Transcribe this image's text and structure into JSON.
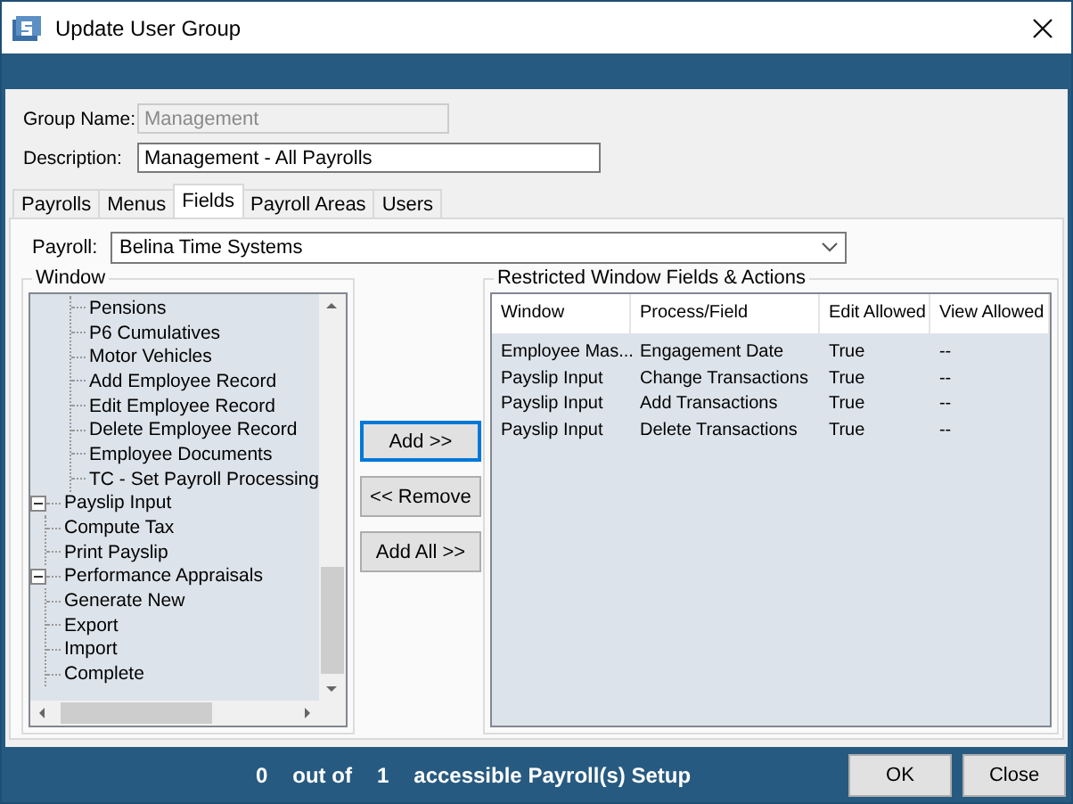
{
  "window": {
    "title": "Update User Group"
  },
  "form": {
    "group_name": {
      "label": "Group Name:",
      "value": "Management",
      "disabled": true
    },
    "description": {
      "label": "Description:",
      "value": "Management - All Payrolls",
      "disabled": false
    }
  },
  "tabs": [
    {
      "label": "Payrolls",
      "selected": false
    },
    {
      "label": "Menus",
      "selected": false
    },
    {
      "label": "Fields",
      "selected": true
    },
    {
      "label": "Payroll Areas",
      "selected": false
    },
    {
      "label": "Users",
      "selected": false
    }
  ],
  "payroll": {
    "label": "Payroll:",
    "value": "Belina Time Systems"
  },
  "window_group": {
    "title": "Window",
    "tree": [
      {
        "children": [
          {
            "label": "Pensions"
          },
          {
            "label": "P6 Cumulatives"
          },
          {
            "label": "Motor Vehicles"
          },
          {
            "label": "Add Employee Record"
          },
          {
            "label": "Edit Employee Record"
          },
          {
            "label": "Delete Employee Record"
          },
          {
            "label": "Employee Documents"
          },
          {
            "label": "TC - Set Payroll Processing"
          }
        ]
      },
      {
        "label": "Payslip Input",
        "expanded": true,
        "children": [
          {
            "label": "Compute Tax"
          },
          {
            "label": "Print Payslip"
          }
        ]
      },
      {
        "label": "Performance Appraisals",
        "expanded": true,
        "children": [
          {
            "label": "Generate New"
          },
          {
            "label": "Export"
          },
          {
            "label": "Import"
          },
          {
            "label": "Complete"
          }
        ]
      }
    ]
  },
  "buttons": [
    {
      "label": "Add >>",
      "focused": true
    },
    {
      "label": "<< Remove",
      "focused": false
    },
    {
      "label": "Add All >>",
      "focused": false
    }
  ],
  "restricted": {
    "title": "Restricted Window Fields & Actions",
    "columns": [
      "Window",
      "Process/Field",
      "Edit Allowed",
      "View Allowed"
    ],
    "rows": [
      [
        "Employee Mas...",
        "Engagement Date",
        "True",
        "--"
      ],
      [
        "Payslip Input",
        "Change Transactions",
        "True",
        "--"
      ],
      [
        "Payslip Input",
        "Add Transactions",
        "True",
        "--"
      ],
      [
        "Payslip Input",
        "Delete Transactions",
        "True",
        "--"
      ]
    ]
  },
  "status_bar": {
    "count": "0",
    "out_of": "out of",
    "total": "1",
    "text": "accessible Payroll(s) Setup"
  },
  "footer_buttons": [
    "OK",
    "Close"
  ]
}
